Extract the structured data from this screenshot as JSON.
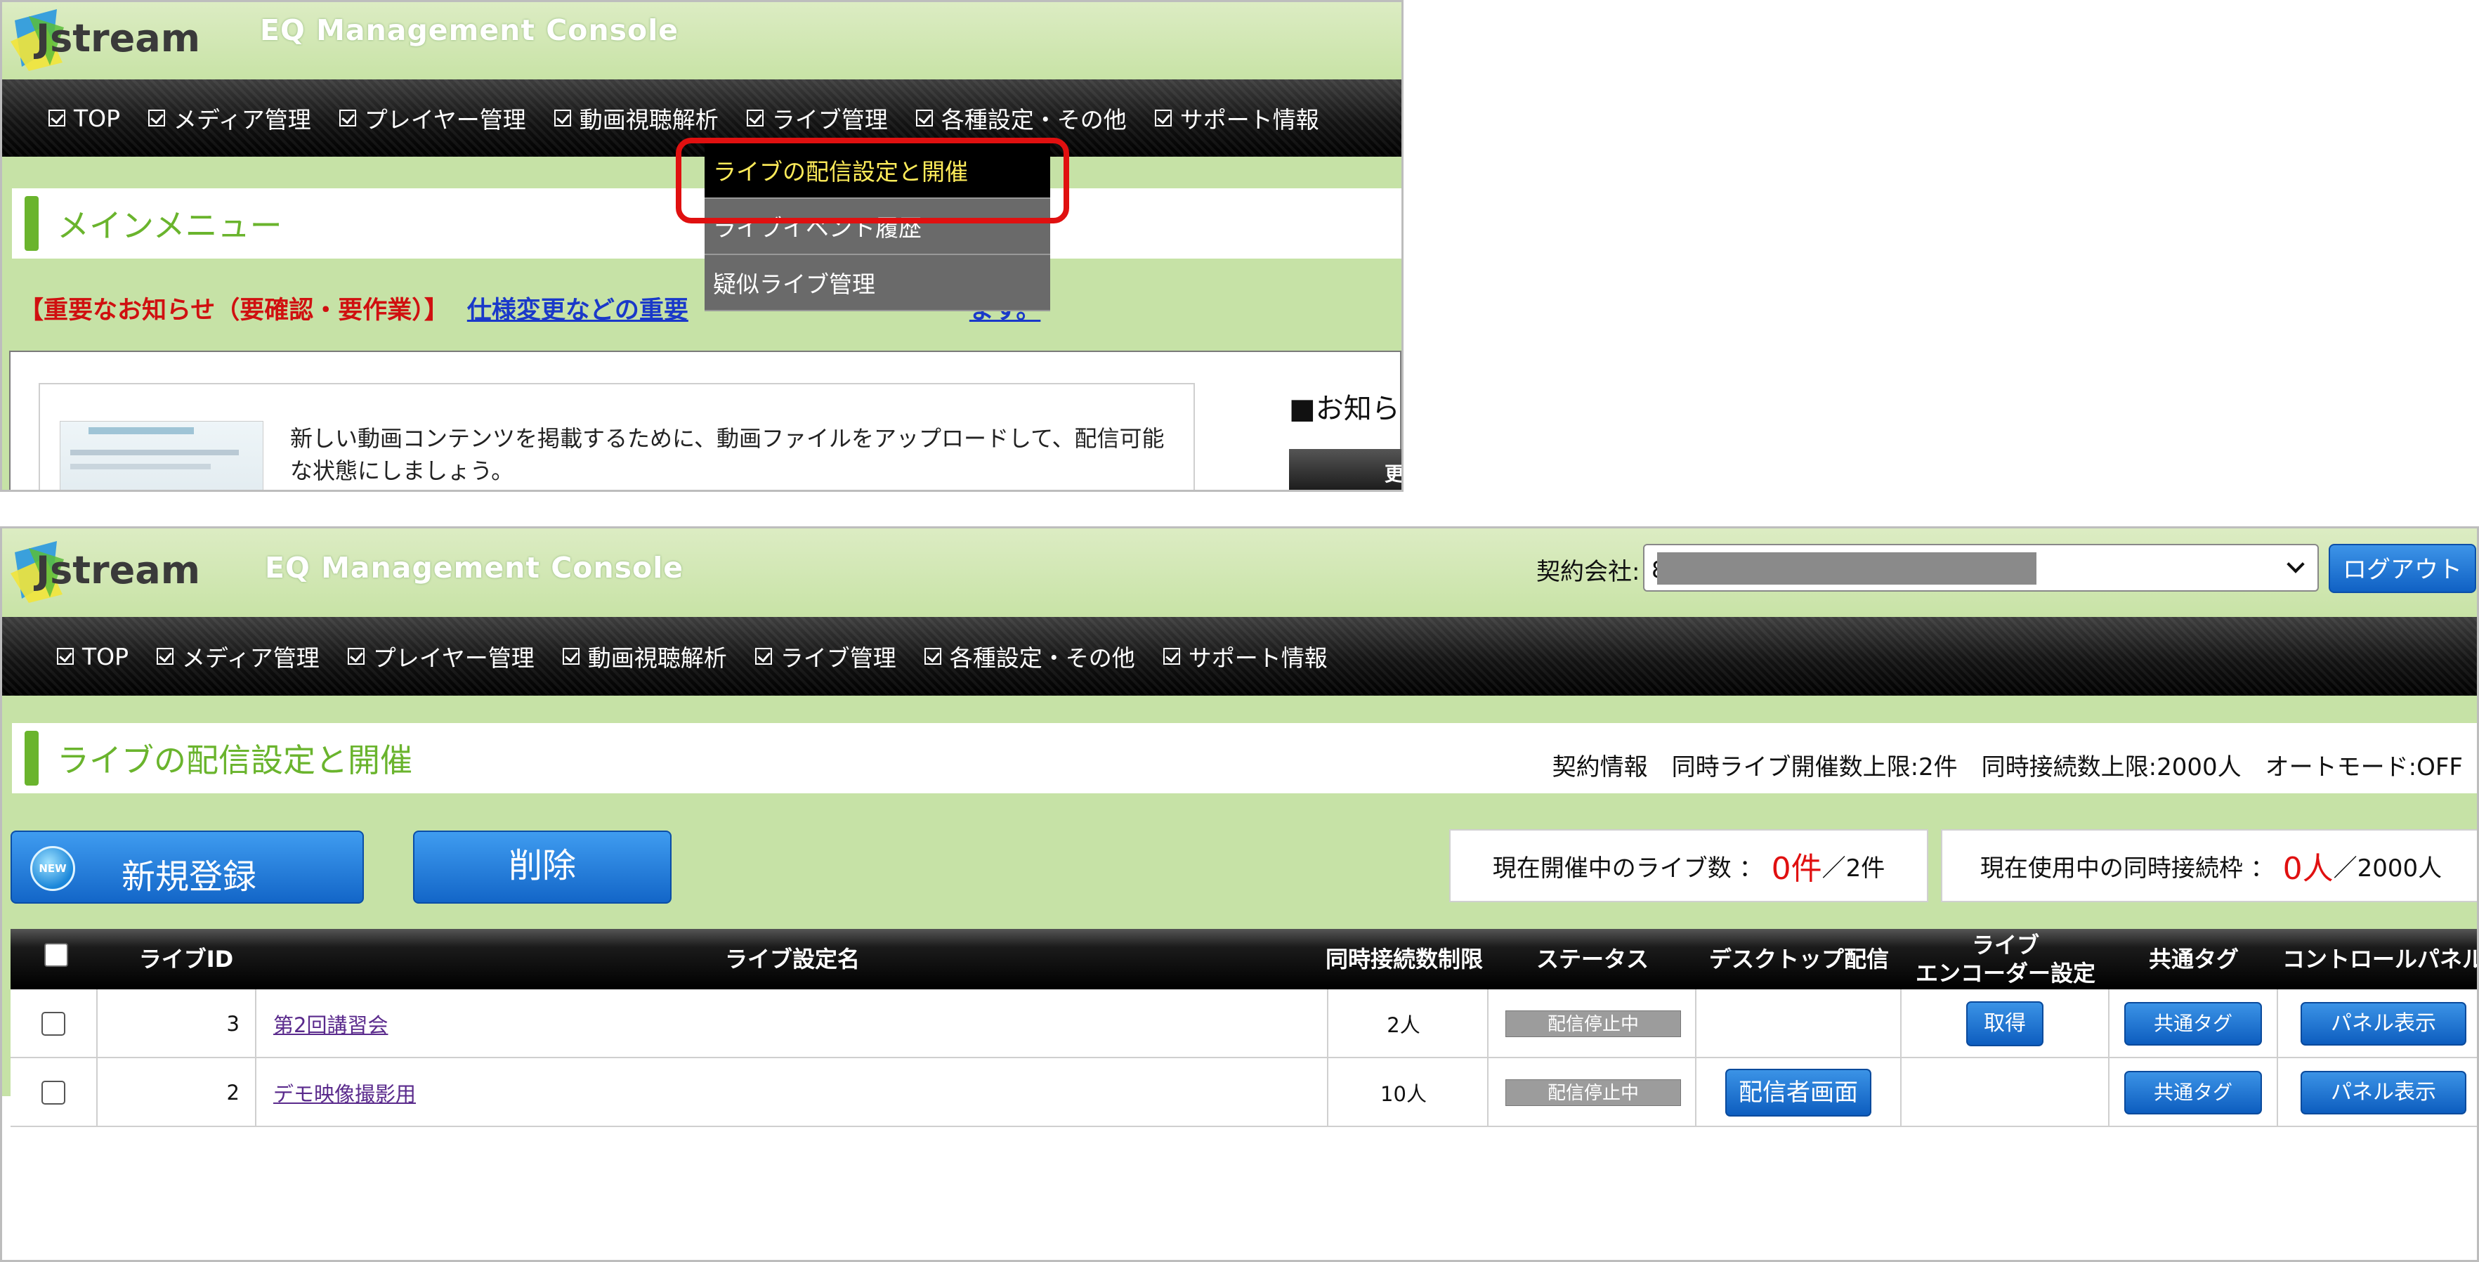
{
  "colors": {
    "header_green": "#c8e3a6",
    "accent_green": "#6ab42d",
    "highlight_red": "#e01010",
    "button_blue": "#1366c8",
    "status_gray": "#9c9c9c"
  },
  "top": {
    "app_title": "EQ Management Console",
    "logo_text": "Jstream",
    "nav": [
      "TOP",
      "メディア管理",
      "プレイヤー管理",
      "動画視聴解析",
      "ライブ管理",
      "各種設定・その他",
      "サポート情報"
    ],
    "dropdown": [
      "ライブの配信設定と開催",
      "ライブイベント履歴",
      "疑似ライブ管理"
    ],
    "page_title": "メインメニュー",
    "notice_red": "【重要なお知らせ（要確認・要作業）】",
    "notice_link": "仕様変更などの重要",
    "notice_link_tail": "ます。",
    "card_text": "新しい動画コンテンツを掲載するために、動画ファイルをアップロードして、配信可能な状態にしましょう。",
    "news_heading": "■お知ら",
    "news_bar": "更"
  },
  "bottom": {
    "app_title": "EQ Management Console",
    "logo_text": "Jstream",
    "contract_label": "契約会社:",
    "contract_value": "8",
    "logout": "ログアウト",
    "nav": [
      "TOP",
      "メディア管理",
      "プレイヤー管理",
      "動画視聴解析",
      "ライブ管理",
      "各種設定・その他",
      "サポート情報"
    ],
    "page_title": "ライブの配信設定と開催",
    "contract_info": {
      "label": "契約情報",
      "concurrent_live": "同時ライブ開催数上限:2件",
      "concurrent_conn": "同時接続数上限:2000人",
      "auto_mode": "オートモード:OFF"
    },
    "btn_new_icon": "NEW",
    "btn_new": "新規登録",
    "btn_delete": "削除",
    "live_count_label": "現在開催中のライブ数 ：",
    "live_count_current": "0件",
    "live_count_limit": "／2件",
    "conn_label": "現在使用中の同時接続枠 ：",
    "conn_current": "0人",
    "conn_limit": "／2000人",
    "table": {
      "headers": {
        "id": "ライブID",
        "name": "ライブ設定名",
        "limit": "同時接続数制限",
        "status": "ステータス",
        "desktop": "デスクトップ配信",
        "encoder_1": "ライブ",
        "encoder_2": "エンコーダー設定",
        "tag": "共通タグ",
        "panel": "コントロールパネル"
      },
      "rows": [
        {
          "id": "3",
          "name": "第2回講習会",
          "limit": "2人",
          "status": "配信停止中",
          "desktop": "",
          "encoder": "取得",
          "tag": "共通タグ",
          "panel": "パネル表示"
        },
        {
          "id": "2",
          "name": "デモ映像撮影用",
          "limit": "10人",
          "status": "配信停止中",
          "desktop": "配信者画面",
          "encoder": "",
          "tag": "共通タグ",
          "panel": "パネル表示"
        }
      ]
    }
  }
}
